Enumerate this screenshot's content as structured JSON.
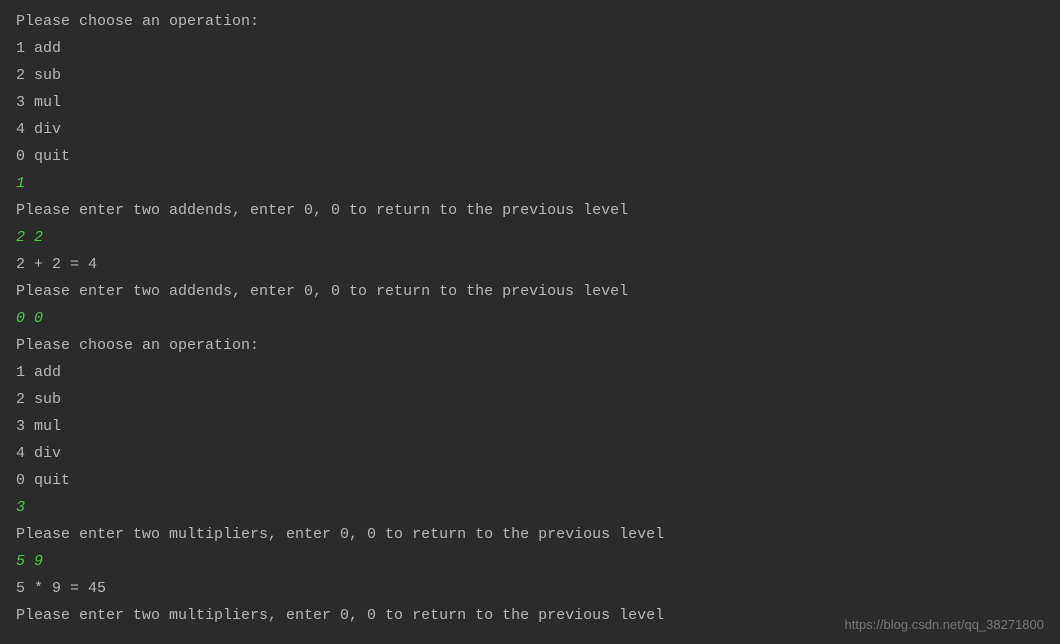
{
  "lines": [
    {
      "type": "output",
      "text": "Please choose an operation: "
    },
    {
      "type": "output",
      "text": "1 add"
    },
    {
      "type": "output",
      "text": "2 sub"
    },
    {
      "type": "output",
      "text": "3 mul"
    },
    {
      "type": "output",
      "text": "4 div"
    },
    {
      "type": "output",
      "text": "0 quit"
    },
    {
      "type": "input",
      "text": "1"
    },
    {
      "type": "output",
      "text": "Please enter two addends, enter 0, 0 to return to the previous level"
    },
    {
      "type": "input",
      "text": "2 2"
    },
    {
      "type": "output",
      "text": "2 + 2 = 4"
    },
    {
      "type": "output",
      "text": "Please enter two addends, enter 0, 0 to return to the previous level"
    },
    {
      "type": "input",
      "text": "0 0"
    },
    {
      "type": "output",
      "text": "Please choose an operation: "
    },
    {
      "type": "output",
      "text": "1 add"
    },
    {
      "type": "output",
      "text": "2 sub"
    },
    {
      "type": "output",
      "text": "3 mul"
    },
    {
      "type": "output",
      "text": "4 div"
    },
    {
      "type": "output",
      "text": "0 quit"
    },
    {
      "type": "input",
      "text": "3"
    },
    {
      "type": "output",
      "text": "Please enter two multipliers, enter 0, 0 to return to the previous level"
    },
    {
      "type": "input",
      "text": "5 9"
    },
    {
      "type": "output",
      "text": "5 * 9 = 45"
    },
    {
      "type": "output",
      "text": "Please enter two multipliers, enter 0, 0 to return to the previous level"
    }
  ],
  "watermark": "https://blog.csdn.net/qq_38271800"
}
